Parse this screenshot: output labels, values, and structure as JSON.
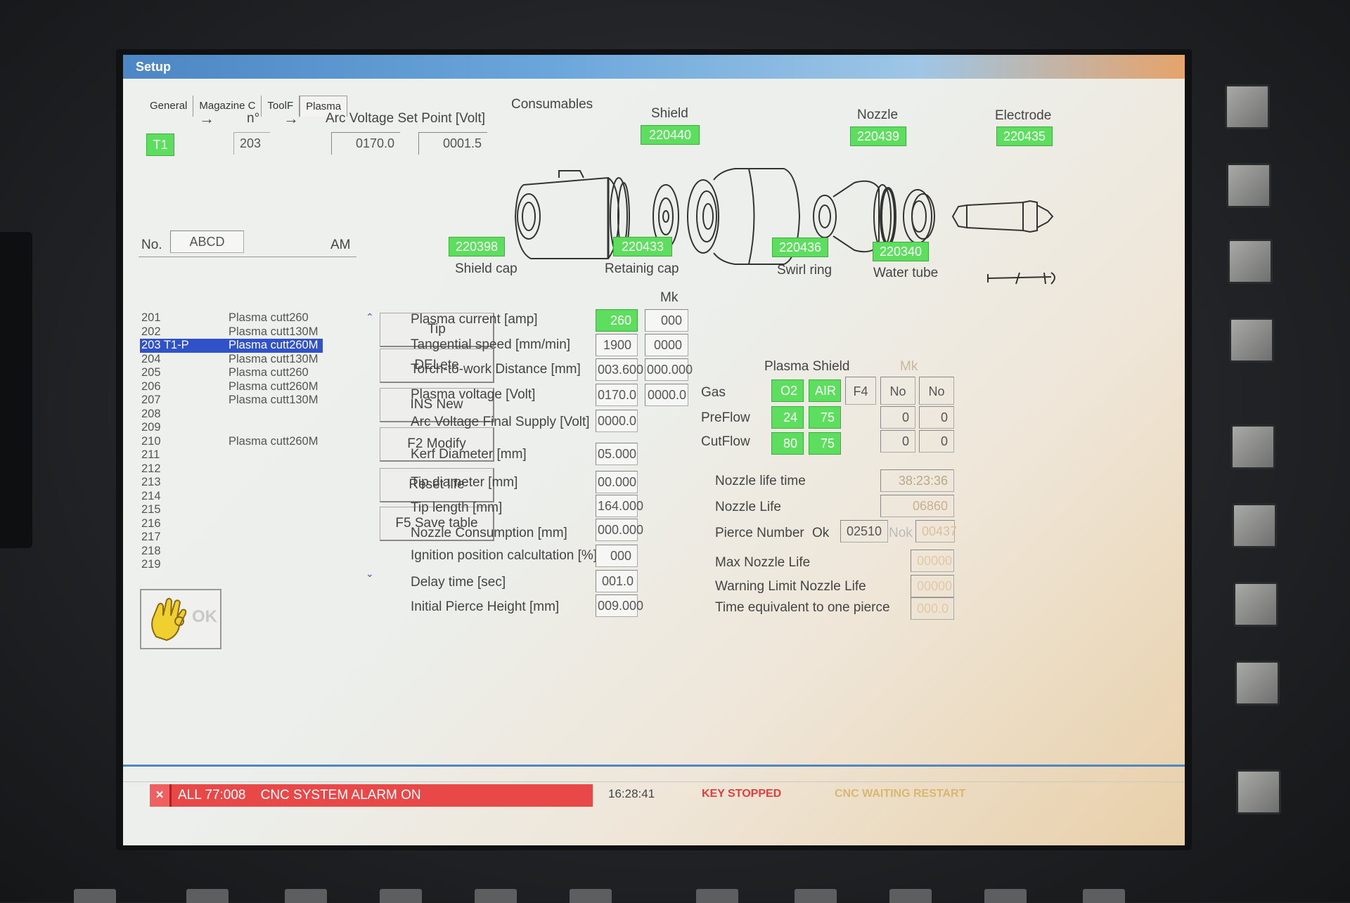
{
  "window": {
    "title": "Setup"
  },
  "tabs": [
    "General",
    "Magazine C",
    "ToolF",
    "Plasma"
  ],
  "header": {
    "arrow1": "→",
    "n_label": "n°",
    "arrow2": "→",
    "arc_set_label": "Arc Voltage Set Point [Volt]",
    "tool": "T1",
    "number": "203",
    "arc_set_value": "0170.0",
    "arc_tol_value": "0001.5"
  },
  "consumables": {
    "title": "Consumables",
    "shield_label": "Shield",
    "shield_code": "220440",
    "nozzle_label": "Nozzle",
    "nozzle_code": "220439",
    "electrode_label": "Electrode",
    "electrode_code": "220435",
    "shield_cap_code": "220398",
    "shield_cap_label": "Shield cap",
    "retaining_cap_code": "220433",
    "retaining_cap_label": "Retainig cap",
    "swirl_ring_code": "220436",
    "swirl_ring_label": "Swirl ring",
    "water_tube_code": "220340",
    "water_tube_label": "Water tube"
  },
  "list": {
    "col_no": "No.",
    "col_abcd": "ABCD",
    "col_am": "AM",
    "rows": [
      {
        "num": "201",
        "name": "Plasma cutt260"
      },
      {
        "num": "202",
        "name": "Plasma cutt130M"
      },
      {
        "num": "203 T1-P",
        "name": "Plasma cutt260M"
      },
      {
        "num": "204",
        "name": "Plasma cutt130M"
      },
      {
        "num": "205",
        "name": "Plasma cutt260"
      },
      {
        "num": "206",
        "name": "Plasma cutt260M"
      },
      {
        "num": "207",
        "name": "Plasma cutt130M"
      },
      {
        "num": "208",
        "name": ""
      },
      {
        "num": "209",
        "name": ""
      },
      {
        "num": "210",
        "name": "Plasma cutt260M"
      },
      {
        "num": "211",
        "name": ""
      },
      {
        "num": "212",
        "name": ""
      },
      {
        "num": "213",
        "name": ""
      },
      {
        "num": "214",
        "name": ""
      },
      {
        "num": "215",
        "name": ""
      },
      {
        "num": "216",
        "name": ""
      },
      {
        "num": "217",
        "name": ""
      },
      {
        "num": "218",
        "name": ""
      },
      {
        "num": "219",
        "name": ""
      }
    ],
    "selected_index": 2
  },
  "buttons": {
    "tip": "Tip",
    "delete": "DELete",
    "ins_new": "INS New",
    "f2_modify": "F2 Modify",
    "reset_life": "Reset life",
    "f5_save": "F5 Save table"
  },
  "ok_label": "OK",
  "params": {
    "mk_header": "Mk",
    "plasma_current_label": "Plasma current [amp]",
    "plasma_current": "260",
    "plasma_current_mk": "000",
    "tangential_speed_label": "Tangential speed [mm/min]",
    "tangential_speed": "1900",
    "tangential_speed_mk": "0000",
    "torch_distance_label": "Torch-to-work Distance [mm]",
    "torch_distance": "003.600",
    "torch_distance_mk": "000.000",
    "plasma_voltage_label": "Plasma voltage [Volt]",
    "plasma_voltage": "0170.0",
    "plasma_voltage_mk": "0000.0",
    "arc_final_label": "Arc Voltage Final Supply [Volt]",
    "arc_final": "0000.0",
    "kerf_label": "Kerf Diameter [mm]",
    "kerf": "05.000",
    "tip_diameter_label": "Tip diameter [mm]",
    "tip_diameter": "00.000",
    "tip_length_label": "Tip length [mm]",
    "tip_length": "164.000",
    "nozzle_consumption_label": "Nozzle Consumption [mm]",
    "nozzle_consumption": "000.000",
    "ignition_label": "Ignition position calcultation [%]",
    "ignition": "000",
    "delay_label": "Delay time [sec]",
    "delay": "001.0",
    "pierce_height_label": "Initial Pierce Height  [mm]",
    "pierce_height": "009.000"
  },
  "gas": {
    "plasma_shield_label": "Plasma Shield",
    "mk_label": "Mk",
    "gas_label": "Gas",
    "gas_plasma": "O2",
    "gas_shield": "AIR",
    "f4_label": "F4",
    "gas_mk1": "No",
    "gas_mk2": "No",
    "preflow_label": "PreFlow",
    "preflow_plasma": "24",
    "preflow_shield": "75",
    "preflow_mk1": "0",
    "preflow_mk2": "0",
    "cutflow_label": "CutFlow",
    "cutflow_plasma": "80",
    "cutflow_shield": "75",
    "cutflow_mk1": "0",
    "cutflow_mk2": "0"
  },
  "nozzle": {
    "life_time_label": "Nozzle life time",
    "life_time": "38:23:36",
    "life_label": "Nozzle Life",
    "life": "06860",
    "pierce_label": "Pierce Number",
    "ok_label": "Ok",
    "pierce_ok": "02510",
    "nok_label": "Nok",
    "pierce_nok": "00437",
    "max_life_label": "Max Nozzle Life",
    "max_life": "00000",
    "warning_label": "Warning Limit Nozzle Life",
    "warning": "00000",
    "equiv_label": "Time equivalent to one pierce",
    "equiv": "000.0"
  },
  "status": {
    "alarm_x": "×",
    "alarm_text": "ALL 77:008    CNC SYSTEM ALARM ON",
    "time": "16:28:41",
    "key": "KEY STOPPED",
    "cnc": "CNC WAITING RESTART"
  },
  "colors": {
    "green": "#5ede5e",
    "selection": "#3151c8",
    "alarm": "#e84848",
    "titlebar": "#4c86c4"
  }
}
